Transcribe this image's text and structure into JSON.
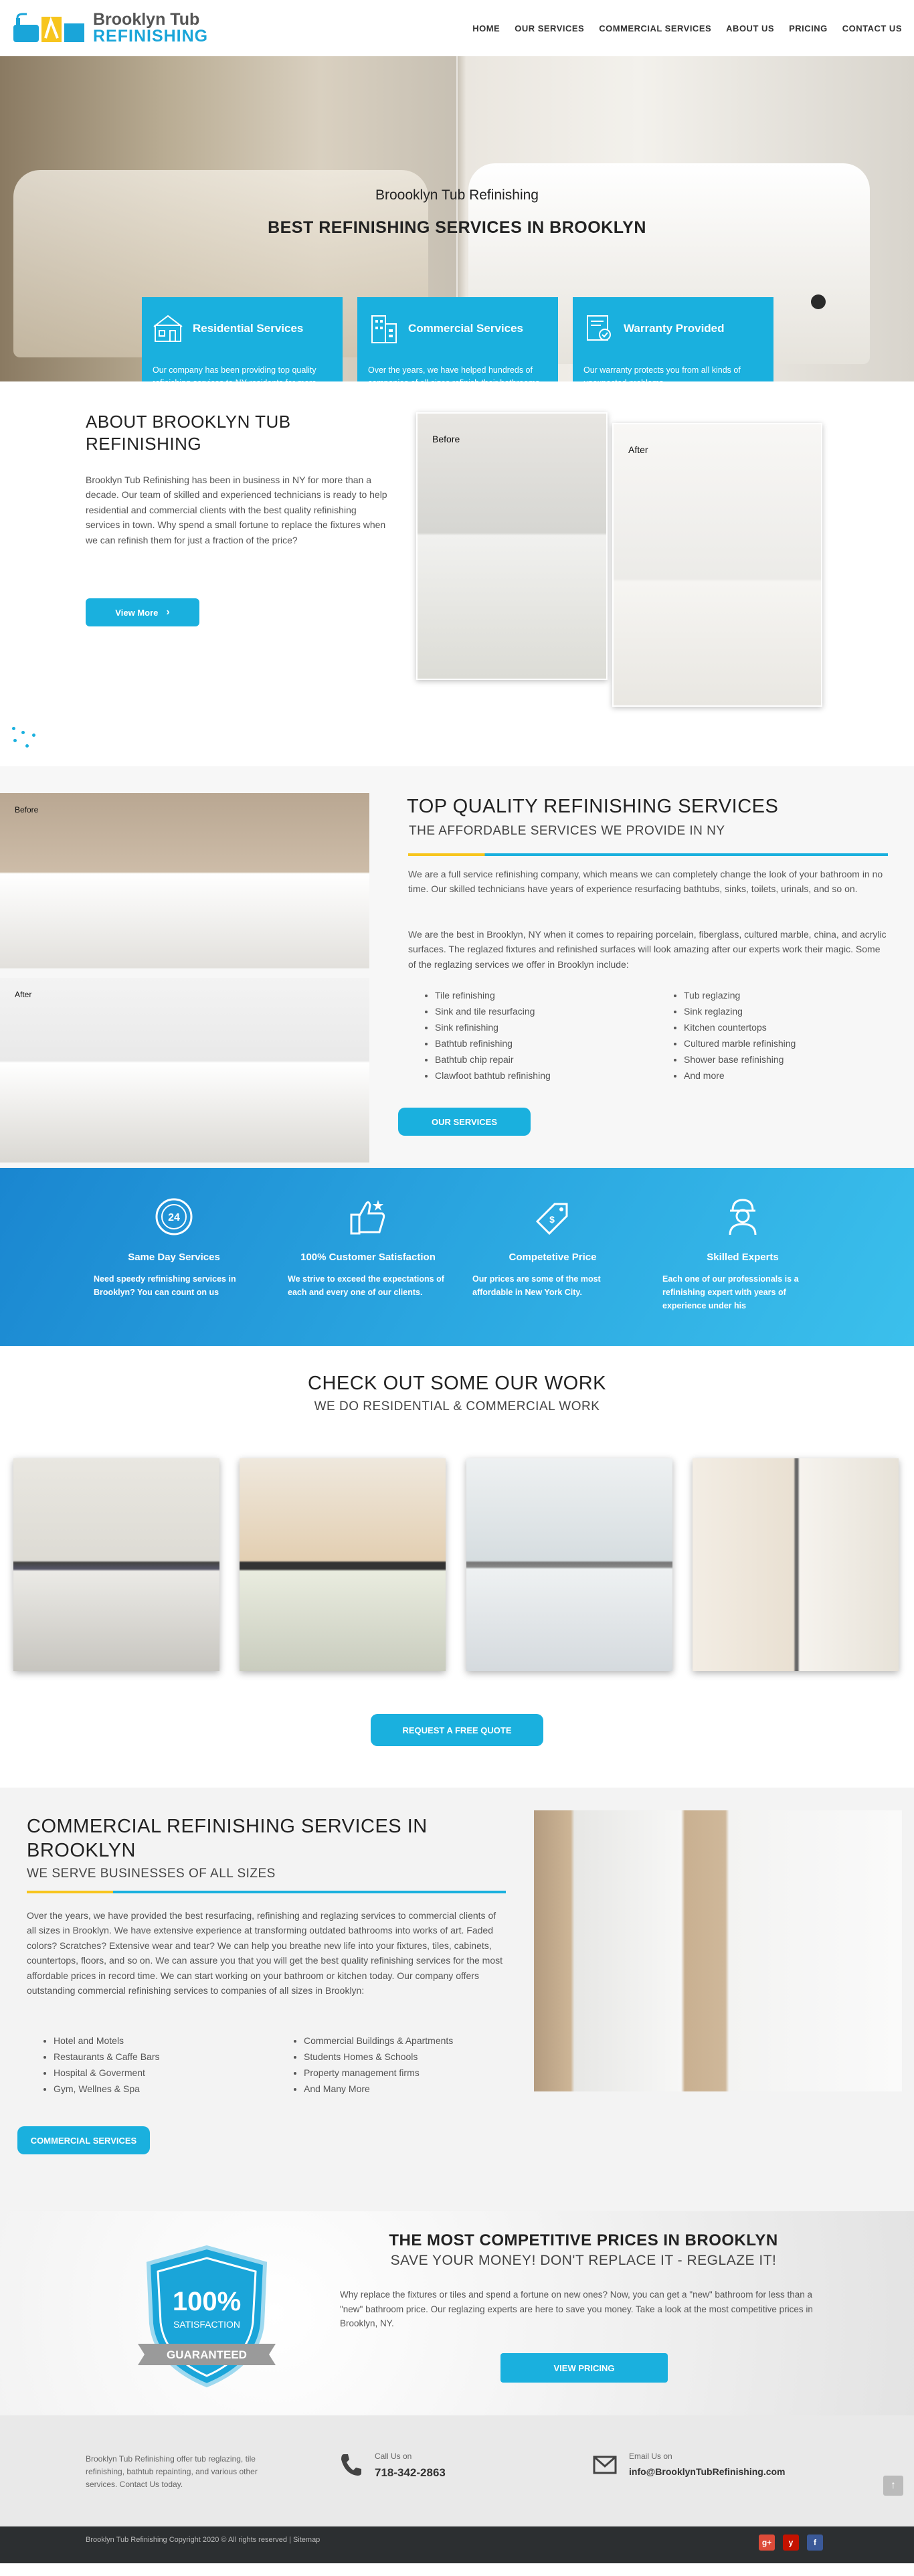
{
  "header": {
    "logo_line1": "Brooklyn Tub",
    "logo_line2": "REFINISHING",
    "nav": [
      "HOME",
      "OUR SERVICES",
      "COMMERCIAL SERVICES",
      "ABOUT US",
      "PRICING",
      "CONTACT US"
    ]
  },
  "hero": {
    "subtitle": "Broooklyn Tub Refinishing",
    "title": "BEST REFINISHING SERVICES IN BROOKLYN",
    "cards": [
      {
        "title": "Residential Services",
        "body": "Our company has been providing top quality refinishing services to NY residents for more than a decade.",
        "icon": "house-icon"
      },
      {
        "title": "Commercial Services",
        "body": "Over the years, we have helped hundreds of companies of all sizes refinish their bathrooms",
        "icon": "building-icon"
      },
      {
        "title": "Warranty Provided",
        "body": "Our warranty protects you from all kinds of unexpected problems.",
        "icon": "certificate-icon"
      }
    ]
  },
  "about": {
    "title": "ABOUT BROOKLYN TUB REFINISHING",
    "body": "Brooklyn Tub Refinishing has been in business in NY for more than a decade. Our team of skilled and experienced technicians is ready to help residential and commercial clients with the best quality refinishing services in town. Why spend a small fortune to replace the fixtures when we can refinish them for just a fraction of the price?",
    "button": "View More",
    "before_label": "Before",
    "after_label": "After"
  },
  "top_quality": {
    "title": "TOP QUALITY REFINISHING SERVICES",
    "subtitle": "THE AFFORDABLE SERVICES WE PROVIDE IN NY",
    "p1": "We are a full service refinishing company, which means we can completely change the look of your bathroom in no time. Our skilled technicians have years of experience resurfacing bathtubs, sinks, toilets, urinals, and so on.",
    "p2": "We are the best in Brooklyn, NY when it comes to repairing porcelain, fiberglass, cultured marble, china, and acrylic surfaces. The reglazed fixtures and refinished surfaces will look amazing after our experts work their magic. Some of the reglazing services we offer in Brooklyn include:",
    "list1": [
      "Tile refinishing",
      "Sink and tile resurfacing",
      "Sink refinishing",
      "Bathtub refinishing",
      "Bathtub chip repair",
      "Clawfoot bathtub refinishing"
    ],
    "list2": [
      "Tub reglazing",
      "Sink reglazing",
      "Kitchen countertops",
      "Cultured marble refinishing",
      "Shower base refinishing",
      "And more"
    ],
    "button": "OUR SERVICES",
    "before_label": "Before",
    "after_label": "After"
  },
  "features": [
    {
      "title": "Same Day Services",
      "body": "Need speedy refinishing services in Brooklyn? You can count on us",
      "icon": "clock-24-icon"
    },
    {
      "title": "100% Customer Satisfaction",
      "body": "We strive to exceed the expectations of each and every one of our clients.",
      "icon": "thumbs-up-icon"
    },
    {
      "title": "Competetive Price",
      "body": "Our prices are some of the most affordable in New York City.",
      "icon": "price-tag-icon"
    },
    {
      "title": "Skilled Experts",
      "body": "Each one of our professionals is a refinishing expert with years of experience under his",
      "icon": "worker-icon"
    }
  ],
  "work": {
    "title": "CHECK OUT SOME OUR WORK",
    "subtitle": "WE DO RESIDENTIAL & COMMERCIAL WORK",
    "button": "REQUEST A FREE QUOTE"
  },
  "commercial": {
    "title": "COMMERCIAL REFINISHING SERVICES IN BROOKLYN",
    "subtitle": "WE SERVE BUSINESSES OF ALL SIZES",
    "body": "Over the years, we have provided the best resurfacing, refinishing and reglazing services to commercial clients of all sizes in Brooklyn. We have extensive experience at transforming outdated bathrooms into works of art. Faded colors? Scratches? Extensive wear and tear? We can help you breathe new life into your fixtures, tiles, cabinets, countertops, floors, and so on. We can assure you that you will get the best quality refinishing services for the most affordable prices in record time. We can start working on your bathroom or kitchen today. Our company offers outstanding commercial refinishing services to companies of all sizes in Brooklyn:",
    "list1": [
      "Hotel and Motels",
      "Restaurants & Caffe Bars",
      "Hospital & Goverment",
      "Gym, Wellnes & Spa"
    ],
    "list2": [
      "Commercial Buildings & Apartments",
      "Students Homes & Schools",
      "Property management firms",
      "And Many More"
    ],
    "button": "COMMERCIAL SERVICES"
  },
  "prices": {
    "badge_big": "100%",
    "badge_small": "SATISFACTION",
    "badge_ribbon": "GUARANTEED",
    "title": "THE MOST COMPETITIVE PRICES IN BROOKLYN",
    "subtitle": "SAVE YOUR MONEY! DON'T REPLACE IT - REGLAZE IT!",
    "body": "Why replace the fixtures or tiles and spend a fortune on new ones? Now, you can get a \"new\" bathroom for less than a \"new\" bathroom price. Our reglazing experts are here to save you money. Take a look at the most competitive prices in Brooklyn, NY.",
    "button": "VIEW PRICING"
  },
  "footer": {
    "about": "Brooklyn Tub Refinishing offer tub reglazing, tile refinishing, bathtub repainting, and various other services. Contact Us today.",
    "call_label": "Call Us on",
    "phone": "718-342-2863",
    "email_label": "Email Us on",
    "email": "info@BrooklynTubRefinishing.com",
    "copyright": "Brooklyn Tub Refinishing Copyright 2020 © All rights reserved | Sitemap",
    "socials": [
      {
        "label": "g+",
        "color": "#dd4b39"
      },
      {
        "label": "y",
        "color": "#c41200"
      },
      {
        "label": "f",
        "color": "#3b5998"
      }
    ]
  }
}
